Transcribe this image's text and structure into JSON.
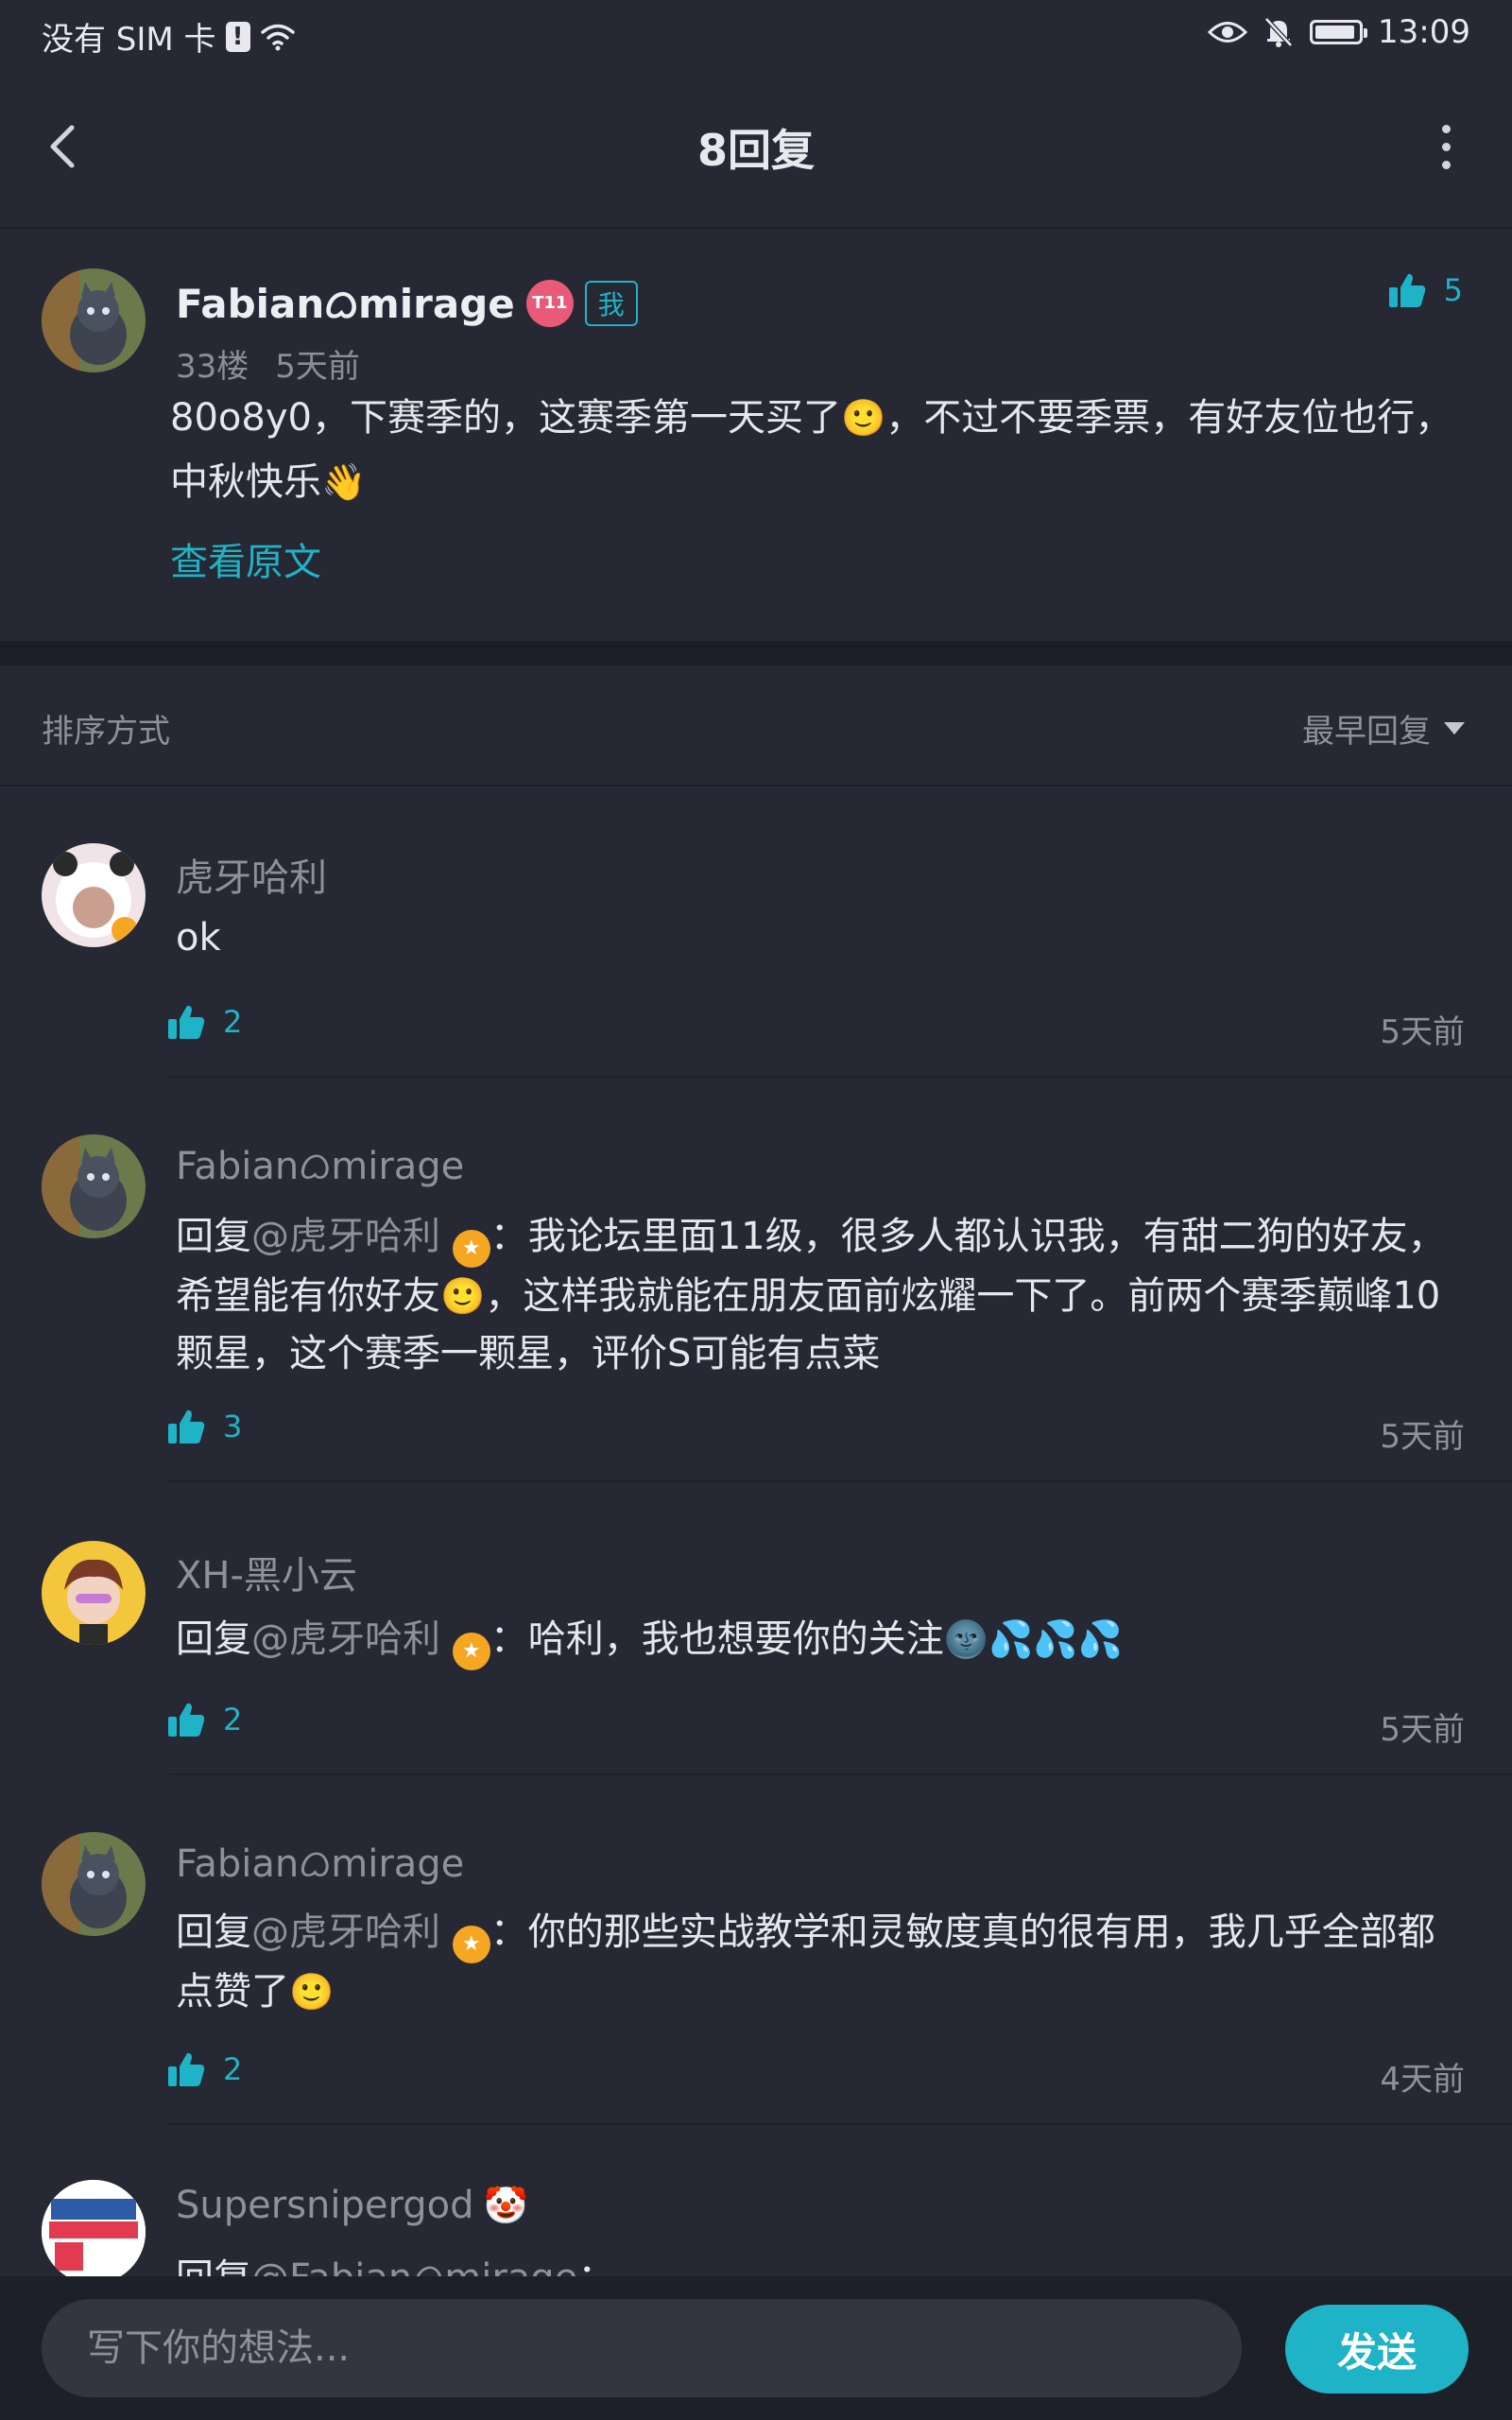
{
  "status_bar": {
    "carrier": "没有 SIM 卡",
    "sim_alert": "!",
    "time": "13:09",
    "icons": [
      "sim-alert-icon",
      "wifi-icon",
      "eye-icon",
      "bell-muted-icon",
      "battery-icon"
    ]
  },
  "nav": {
    "title": "8回复",
    "back_icon": "chevron-left-icon",
    "more_icon": "more-vertical-icon"
  },
  "post": {
    "author": "Fabianᜊmirage",
    "level_badge": "T11",
    "me_tag": "我",
    "floor": "33楼",
    "time": "5天前",
    "likes": "5",
    "text_part1": "80o8y0，下赛季的，这赛季第一天买了",
    "text_part2": "，不过不要季票，有好友位也行，中秋快乐",
    "emojis": [
      "🙂",
      "👋"
    ],
    "view_original": "查看原文"
  },
  "sort": {
    "label": "排序方式",
    "selected": "最早回复"
  },
  "replies": [
    {
      "author": "虎牙哈利",
      "text": "ok",
      "likes": "2",
      "time": "5天前"
    },
    {
      "author": "Fabianᜊmirage",
      "prefix": "回复",
      "mention": "@虎牙哈利",
      "text_a": "：我论坛里面11级，很多人都认识我，有甜二狗的好友，希望能有你好友",
      "text_b": "，这样我就能在朋友面前炫耀一下了。前两个赛季巅峰10颗星，这个赛季一颗星，评价S可能有点菜",
      "likes": "3",
      "time": "5天前"
    },
    {
      "author": "XH-黑小云",
      "prefix": "回复",
      "mention": "@虎牙哈利",
      "text_a": "：哈利，我也想要你的关注",
      "emojis": "🌚💦💦💦",
      "likes": "2",
      "time": "5天前"
    },
    {
      "author": "Fabianᜊmirage",
      "prefix": "回复",
      "mention": "@虎牙哈利",
      "text_a": "：你的那些实战教学和灵敏度真的很有用，我几乎全部都点赞了",
      "likes": "2",
      "time": "4天前"
    },
    {
      "author": "Supersnipergod",
      "prefix": "回复",
      "mention": "@Fabianᜊmirage",
      "text_a": "："
    }
  ],
  "composer": {
    "placeholder": "写下你的想法...",
    "send_label": "发送"
  },
  "colors": {
    "background": "#262833",
    "accent": "#1FB3C7",
    "muted_text": "#8E919C"
  }
}
